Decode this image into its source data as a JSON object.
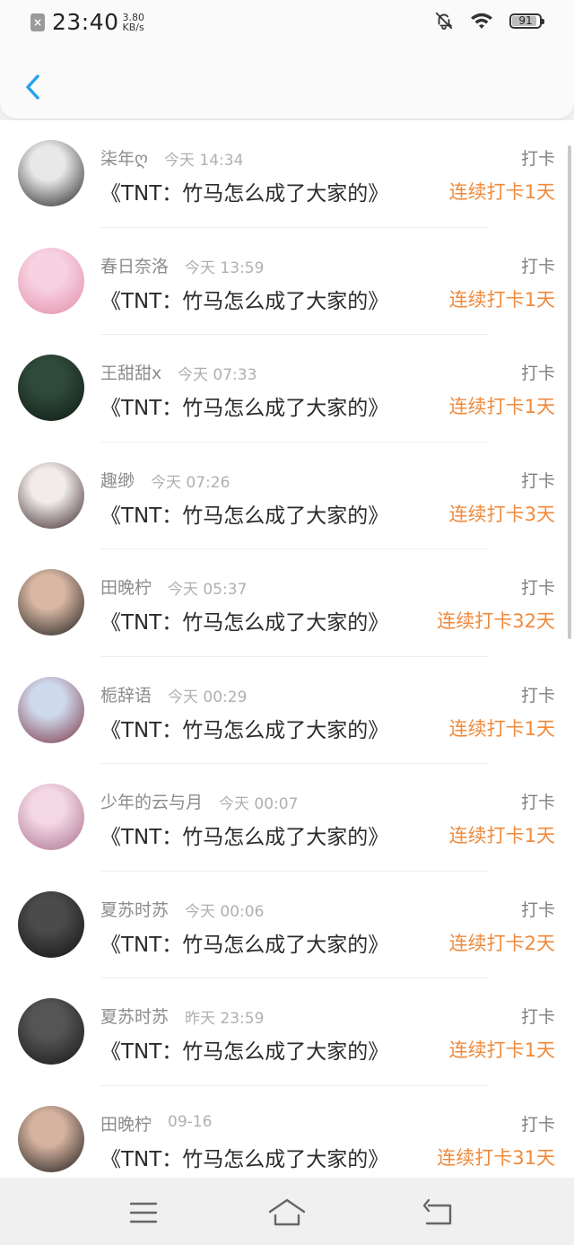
{
  "status_bar": {
    "time": "23:40",
    "speed_value": "3.80",
    "speed_unit": "KB/s",
    "battery": "91",
    "battery_level": 0.91
  },
  "list_title": "《TNT：竹马怎么成了大家的》",
  "list": [
    {
      "user": "柒年ღ",
      "time": "今天 14:34",
      "label": "打卡",
      "streak": "连续打卡1天",
      "avatar_colors": [
        "#e8e8e8",
        "#222222"
      ]
    },
    {
      "user": "春日奈洛",
      "time": "今天 13:59",
      "label": "打卡",
      "streak": "连续打卡1天",
      "avatar_colors": [
        "#f7d3e2",
        "#e48aa8"
      ]
    },
    {
      "user": "王甜甜x",
      "time": "今天 07:33",
      "label": "打卡",
      "streak": "连续打卡1天",
      "avatar_colors": [
        "#2f4a3a",
        "#0e1a14"
      ]
    },
    {
      "user": "趣缈",
      "time": "今天 07:26",
      "label": "打卡",
      "streak": "连续打卡3天",
      "avatar_colors": [
        "#f1ece9",
        "#3a2428"
      ]
    },
    {
      "user": "田晚柠",
      "time": "今天 05:37",
      "label": "打卡",
      "streak": "连续打卡32天",
      "avatar_colors": [
        "#d9b7a3",
        "#1c1c1c"
      ]
    },
    {
      "user": "栀辞语",
      "time": "今天 00:29",
      "label": "打卡",
      "streak": "连续打卡1天",
      "avatar_colors": [
        "#cfd9ec",
        "#7a3342"
      ]
    },
    {
      "user": "少年的云与月",
      "time": "今天 00:07",
      "label": "打卡",
      "streak": "连续打卡1天",
      "avatar_colors": [
        "#f3d7e4",
        "#a9708c"
      ]
    },
    {
      "user": "夏苏时苏",
      "time": "今天 00:06",
      "label": "打卡",
      "streak": "连续打卡2天",
      "avatar_colors": [
        "#4b4b4b",
        "#111111"
      ]
    },
    {
      "user": "夏苏时苏",
      "time": "昨天 23:59",
      "label": "打卡",
      "streak": "连续打卡1天",
      "avatar_colors": [
        "#555555",
        "#151515"
      ]
    },
    {
      "user": "田晚柠",
      "time": "09-16",
      "label": "打卡",
      "streak": "连续打卡31天",
      "avatar_colors": [
        "#d6b3a0",
        "#1a1a1a"
      ]
    }
  ],
  "colors": {
    "accent": "#2aa0f0",
    "streak": "#f08a3c",
    "username": "#8c8c8c",
    "time": "#b0b0b0"
  },
  "icons": {
    "back": "chevron-left-icon",
    "menu": "menu-icon",
    "home": "home-icon",
    "return": "return-icon"
  }
}
